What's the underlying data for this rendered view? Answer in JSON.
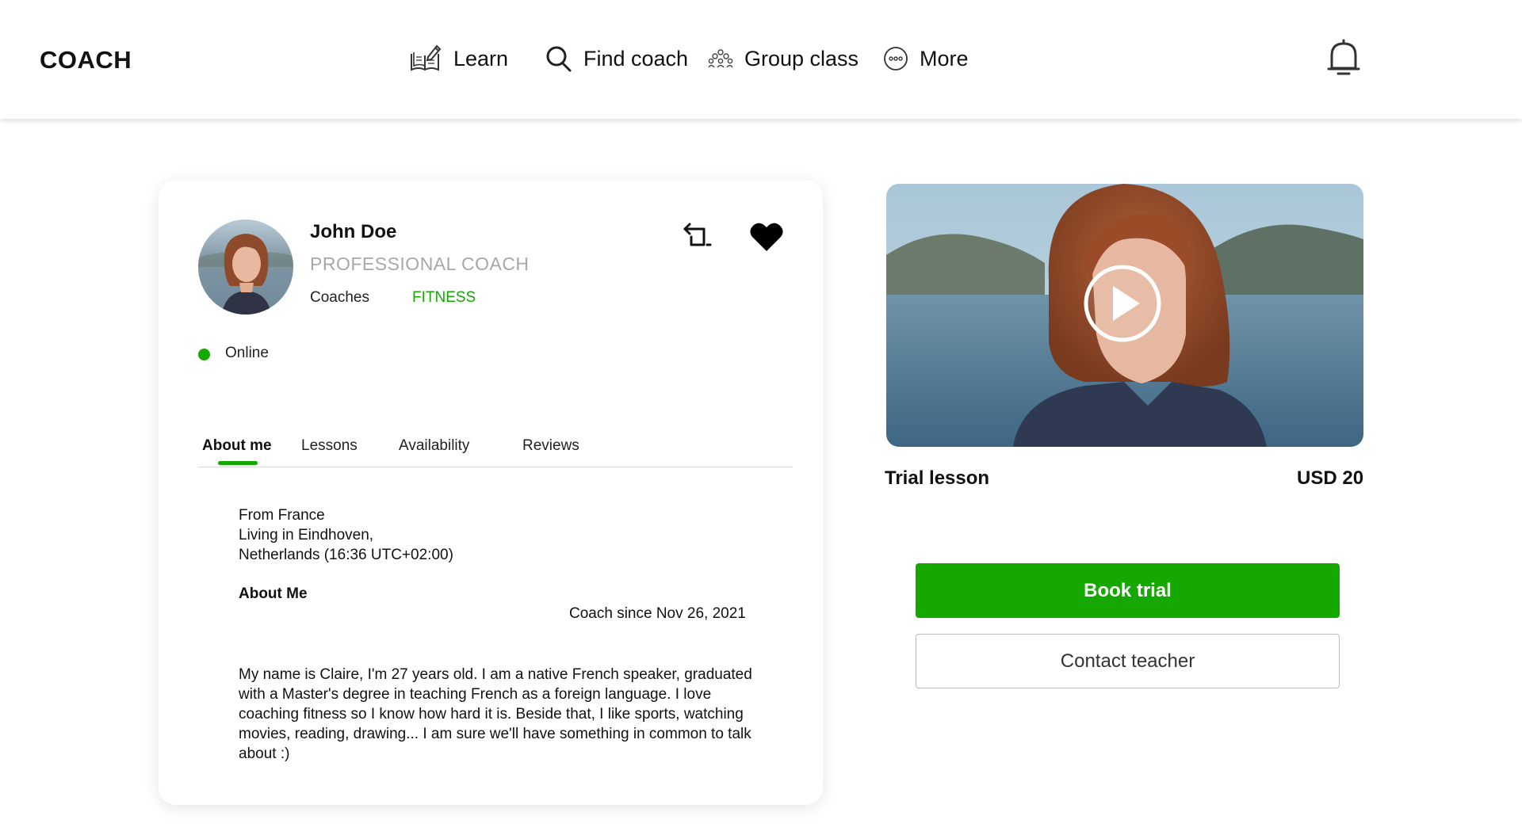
{
  "header": {
    "brand": "COACH",
    "nav": [
      {
        "label": "Learn",
        "icon": "book-pencil-icon"
      },
      {
        "label": "Find coach",
        "icon": "search-icon"
      },
      {
        "label": "Group class",
        "icon": "group-icon"
      },
      {
        "label": "More",
        "icon": "more-dots-icon"
      }
    ],
    "notifications_icon": "bell-icon"
  },
  "profile": {
    "name": "John Doe",
    "title": "PROFESSIONAL COACH",
    "coaches_label": "Coaches",
    "category": "FITNESS",
    "status": "Online",
    "status_color": "#14a800",
    "tabs": [
      "About me",
      "Lessons",
      "Availability",
      "Reviews"
    ],
    "active_tab": "About me",
    "location": [
      "From France",
      "Living in Eindhoven,",
      "Netherlands (16:36 UTC+02:00)"
    ],
    "about_heading": "About Me",
    "coach_since": "Coach since Nov 26, 2021",
    "bio": "My name is Claire, I'm 27 years old. I am a native French speaker, graduated with a Master's degree in teaching French as a foreign language. I love coaching fitness so I know how hard it is. Beside that, I like sports, watching movies, reading, drawing... I am sure we'll have something in common to talk about :)"
  },
  "trial": {
    "label": "Trial lesson",
    "price": "USD 20",
    "book_button": "Book trial",
    "contact_button": "Contact teacher",
    "accent_color": "#14a800"
  }
}
